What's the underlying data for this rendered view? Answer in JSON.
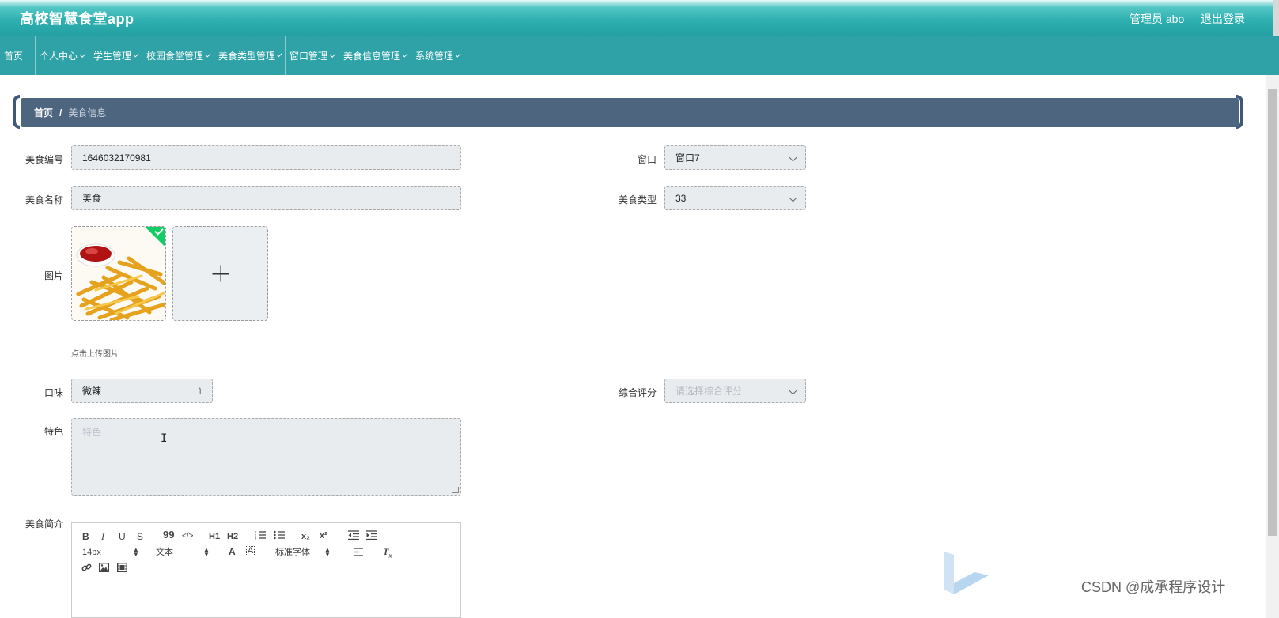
{
  "header": {
    "app_title": "高校智慧食堂app",
    "user_label": "管理员 abo",
    "logout_label": "退出登录"
  },
  "nav": {
    "items": [
      {
        "label": "首页",
        "has_dropdown": false
      },
      {
        "label": "个人中心",
        "has_dropdown": true
      },
      {
        "label": "学生管理",
        "has_dropdown": true
      },
      {
        "label": "校园食堂管理",
        "has_dropdown": true
      },
      {
        "label": "美食类型管理",
        "has_dropdown": true
      },
      {
        "label": "窗口管理",
        "has_dropdown": true
      },
      {
        "label": "美食信息管理",
        "has_dropdown": true
      },
      {
        "label": "系统管理",
        "has_dropdown": true
      }
    ]
  },
  "breadcrumb": {
    "home": "首页",
    "separator": "/",
    "current": "美食信息"
  },
  "form": {
    "food_no": {
      "label": "美食编号",
      "value": "1646032170981"
    },
    "window": {
      "label": "窗口",
      "value": "窗口7"
    },
    "food_name": {
      "label": "美食名称",
      "value": "美食"
    },
    "food_type": {
      "label": "美食类型",
      "value": "33"
    },
    "image": {
      "label": "图片",
      "hint": "点击上传图片",
      "uploaded_icon": "fries-image",
      "add_icon": "plus-icon"
    },
    "taste": {
      "label": "口味",
      "value": "微辣"
    },
    "rating": {
      "label": "综合评分",
      "placeholder": "请选择综合评分"
    },
    "feature": {
      "label": "特色",
      "placeholder": "特色"
    },
    "intro": {
      "label": "美食简介"
    }
  },
  "editor": {
    "toolbar": {
      "bold": "B",
      "italic": "I",
      "underline": "U",
      "strike": "S",
      "quote": "99",
      "code": "</>",
      "h1": "H1",
      "h2": "H2",
      "subscript": "x₂",
      "superscript": "x²",
      "font_size": "14px",
      "header_select": "文本",
      "font_family": "标准字体"
    }
  },
  "watermark": "CSDN @成承程序设计",
  "colors": {
    "header_teal": "#2fb0b0",
    "nav_teal": "#2ea2a6",
    "breadcrumb_bg": "#4e6580",
    "success_green": "#13ce66"
  }
}
